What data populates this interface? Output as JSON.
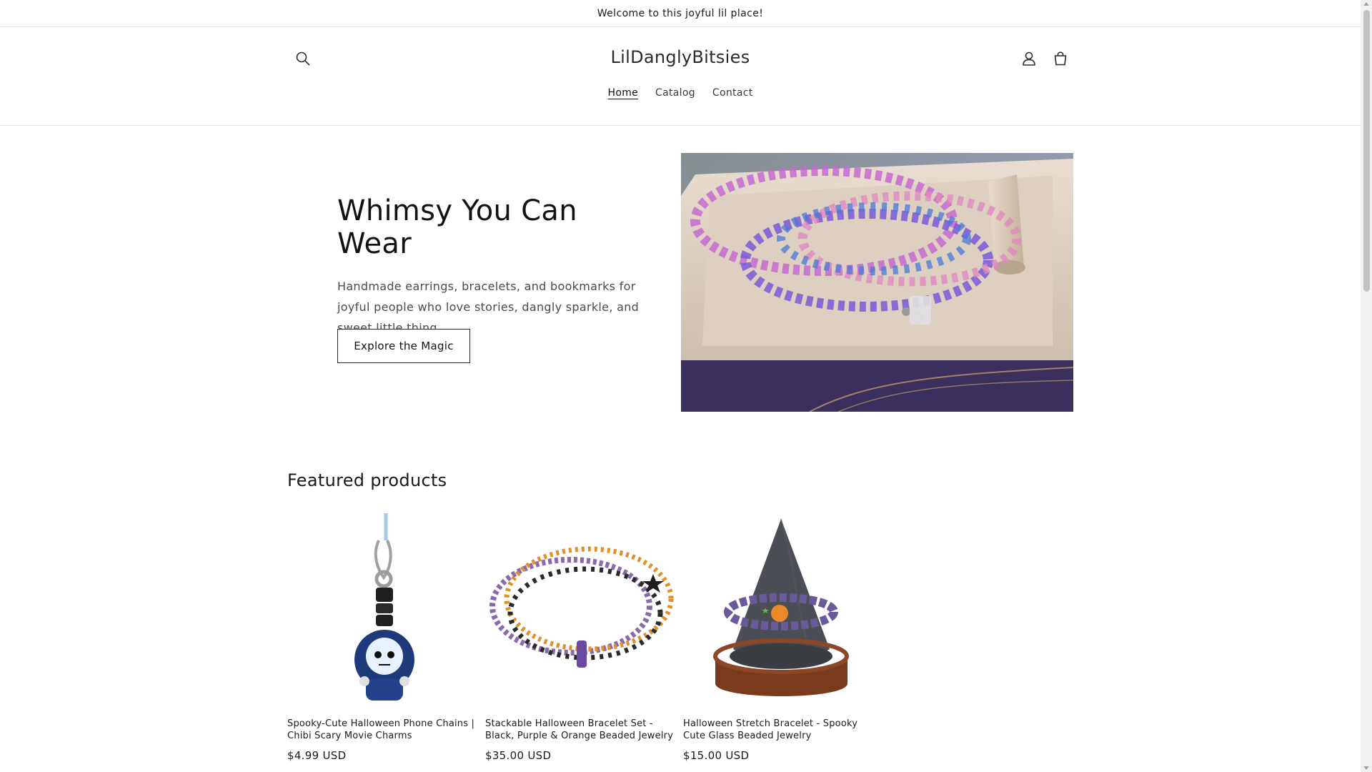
{
  "announcement": {
    "text": "Welcome to this joyful lil place!"
  },
  "header": {
    "logo": "LilDanglyBitsies",
    "icons": {
      "search": "search-icon",
      "account": "account-icon",
      "cart": "cart-icon"
    },
    "nav": [
      {
        "label": "Home",
        "active": true
      },
      {
        "label": "Catalog",
        "active": false
      },
      {
        "label": "Contact",
        "active": false
      }
    ]
  },
  "hero": {
    "title": "Whimsy You Can Wear",
    "description": "Handmade earrings, bracelets, and bookmarks for joyful people who love stories, dangly sparkle, and sweet little thing.",
    "button": "Explore the Magic"
  },
  "featured": {
    "title": "Featured products",
    "products": [
      {
        "name": "Spooky-Cute Halloween Phone Chains | Chibi Scary Movie Charms",
        "price": "$4.99 USD"
      },
      {
        "name": "Stackable Halloween Bracelet Set - Black, Purple & Orange Beaded Jewelry",
        "price": "$35.00 USD"
      },
      {
        "name": "Halloween Stretch Bracelet - Spooky Cute Glass Beaded Jewelry",
        "price": "$15.00 USD"
      }
    ]
  }
}
